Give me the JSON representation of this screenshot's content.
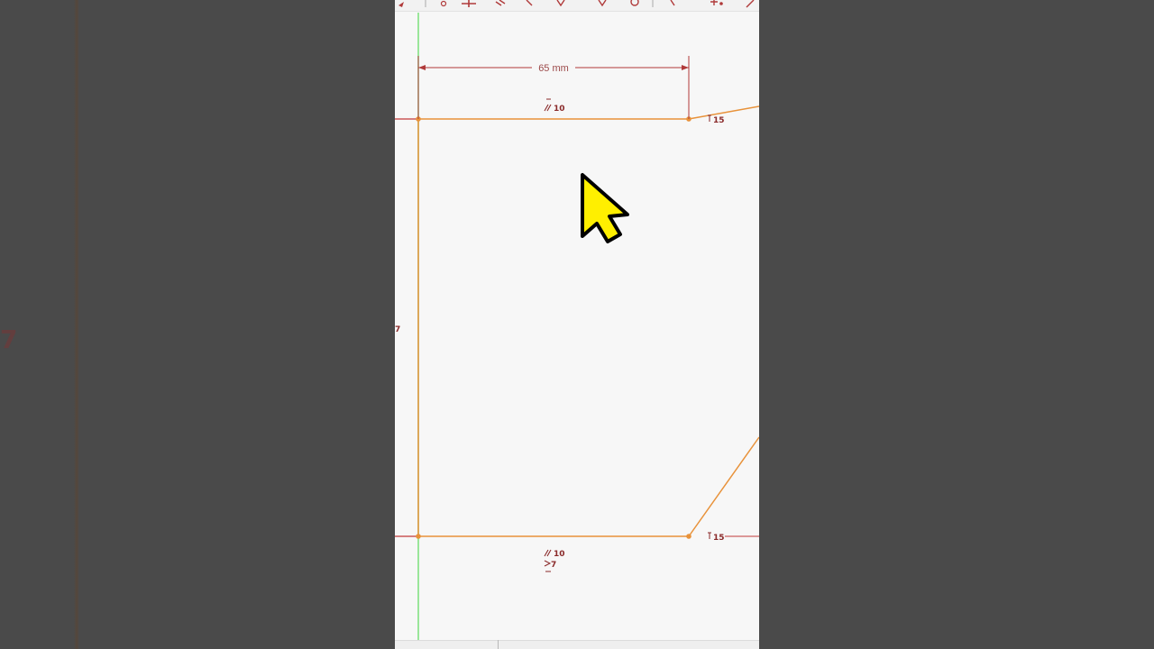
{
  "backdrop": {
    "side_label": "7"
  },
  "sketch": {
    "dimension_label": "65 mm",
    "top_edge_constraint": "10",
    "top_right_constraint": "15",
    "bottom_edge_constraint": "10",
    "bottom_edge_angle_constraint": "7",
    "bottom_right_constraint": "15",
    "left_edge_constraint": "7"
  },
  "colors": {
    "sketch_line": "#e8923a",
    "dimension": "#b03a3a",
    "axis_vertical": "#7be07b",
    "cursor_fill": "#ffef00",
    "background": "#f7f7f7"
  },
  "cursor": {
    "icon": "arrow-pointer-icon"
  }
}
